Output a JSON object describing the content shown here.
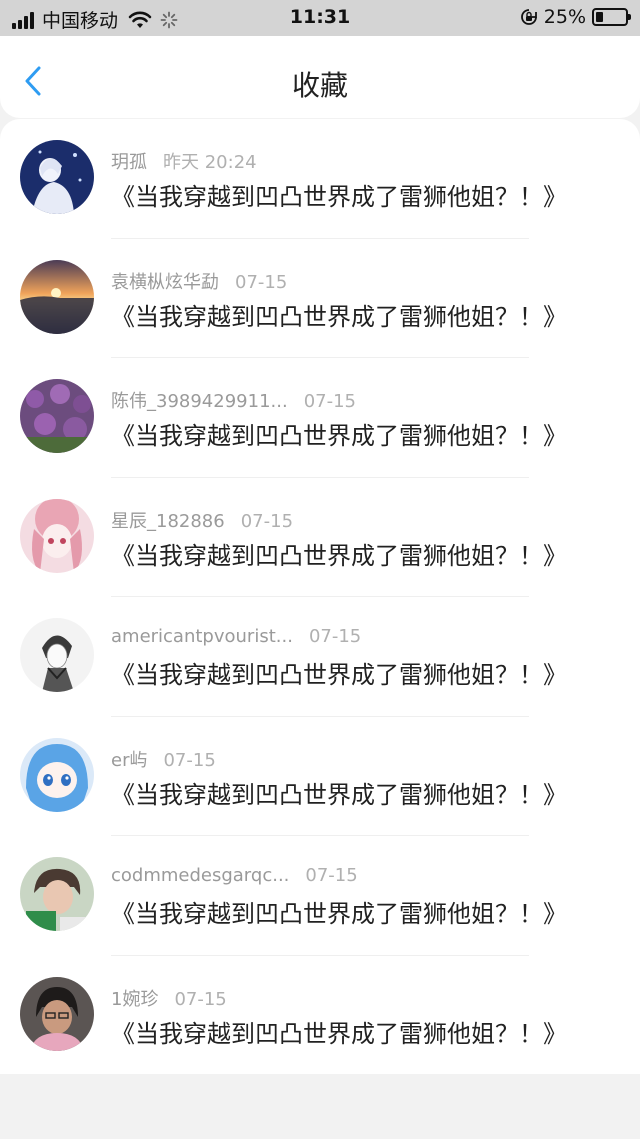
{
  "status_bar": {
    "carrier": "中国移动",
    "time": "11:31",
    "battery_percent": "25%",
    "battery_level": 0.25
  },
  "header": {
    "title": "收藏"
  },
  "items": [
    {
      "user": "玥孤",
      "time": "昨天 20:24",
      "title": "《当我穿越到凹凸世界成了雷狮他姐？！》"
    },
    {
      "user": "袁横枞炫华勐",
      "time": "07-15",
      "title": "《当我穿越到凹凸世界成了雷狮他姐？！》"
    },
    {
      "user": "陈伟_3989429911...",
      "time": "07-15",
      "title": "《当我穿越到凹凸世界成了雷狮他姐？！》"
    },
    {
      "user": "星辰_182886",
      "time": "07-15",
      "title": "《当我穿越到凹凸世界成了雷狮他姐？！》"
    },
    {
      "user": "americantpvourist...",
      "time": "07-15",
      "title": "《当我穿越到凹凸世界成了雷狮他姐？！》"
    },
    {
      "user": "er屿",
      "time": "07-15",
      "title": "《当我穿越到凹凸世界成了雷狮他姐？！》"
    },
    {
      "user": "codmmedesgarqc...",
      "time": "07-15",
      "title": "《当我穿越到凹凸世界成了雷狮他姐？！》"
    },
    {
      "user": "1婉珍",
      "time": "07-15",
      "title": "《当我穿越到凹凸世界成了雷狮他姐？！》"
    }
  ],
  "colors": {
    "accent": "#2e9cf2",
    "status_bar_bg": "#d4d4d4",
    "page_bg": "#f2f2f2"
  }
}
